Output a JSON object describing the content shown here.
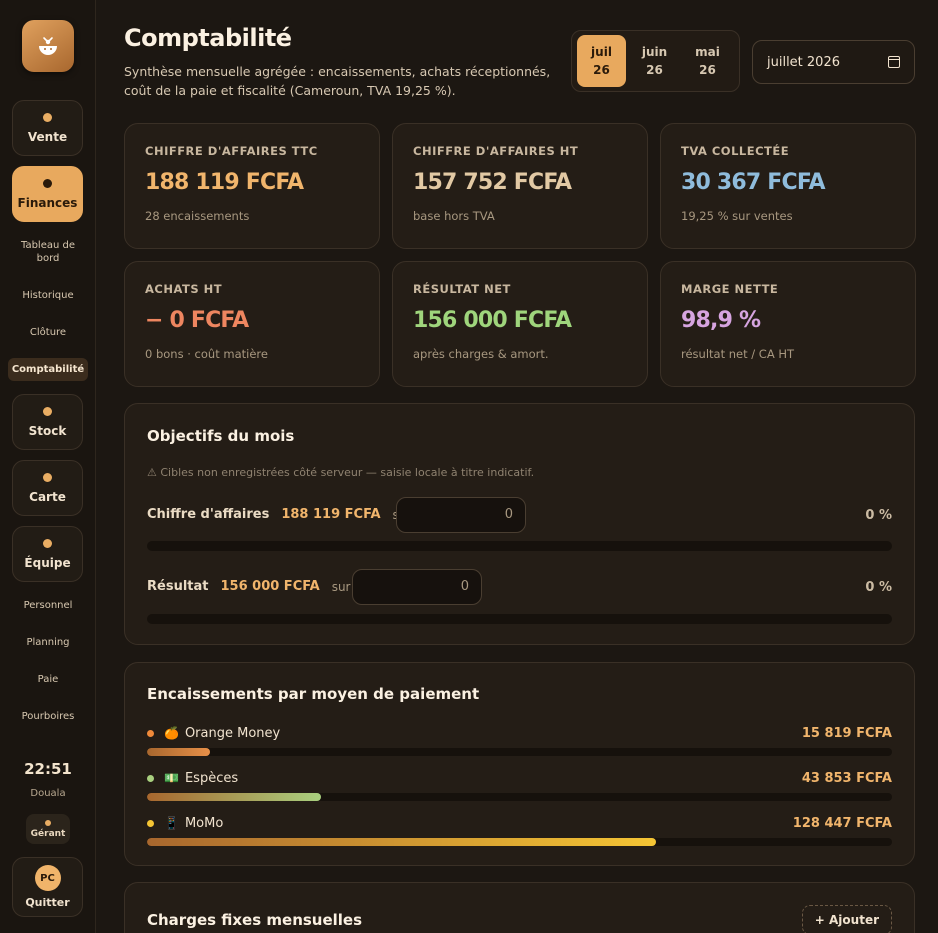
{
  "sidebar": {
    "nav": {
      "vente": "Vente",
      "finances": "Finances",
      "stock": "Stock",
      "carte": "Carte",
      "equipe": "Équipe"
    },
    "finances_sub": [
      "Tableau de bord",
      "Historique",
      "Clôture",
      "Comptabilité"
    ],
    "equipe_sub": [
      "Personnel",
      "Planning",
      "Paie",
      "Pourboires"
    ],
    "clock": "22:51",
    "city": "Douala",
    "role": "Gérant",
    "user_initials": "PC",
    "quit": "Quitter"
  },
  "header": {
    "title": "Comptabilité",
    "subtitle": "Synthèse mensuelle agrégée : encaissements, achats réceptionnés, coût de la paie et fiscalité (Cameroun, TVA 19,25 %).",
    "months": [
      {
        "m": "juil",
        "y": "26"
      },
      {
        "m": "juin",
        "y": "26"
      },
      {
        "m": "mai",
        "y": "26"
      }
    ],
    "date_value": "juillet 2026"
  },
  "kpis": [
    {
      "label": "CHIFFRE D'AFFAIRES TTC",
      "value": "188 119 FCFA",
      "note": "28 encaissements",
      "color": "#f1b56c"
    },
    {
      "label": "CHIFFRE D'AFFAIRES HT",
      "value": "157 752 FCFA",
      "note": "base hors TVA",
      "color": "#e2c9a4"
    },
    {
      "label": "TVA COLLECTÉE",
      "value": "30 367 FCFA",
      "note": "19,25 % sur ventes",
      "color": "#8fbcdc"
    },
    {
      "label": "ACHATS HT",
      "value": "− 0 FCFA",
      "note": "0 bons · coût matière",
      "color": "#ee8660"
    },
    {
      "label": "RÉSULTAT NET",
      "value": "156 000 FCFA",
      "note": "après charges & amort.",
      "color": "#9fd57c"
    },
    {
      "label": "MARGE NETTE",
      "value": "98,9 %",
      "note": "résultat net / CA HT",
      "color": "#d6a4e0"
    }
  ],
  "objectives": {
    "title": "Objectifs du mois",
    "warning": "⚠ Cibles non enregistrées côté serveur — saisie locale à titre indicatif.",
    "rows": [
      {
        "label": "Chiffre d'affaires",
        "value": "188 119 FCFA",
        "sur": "sur",
        "input": "0",
        "pct": "0 %",
        "progress": 0
      },
      {
        "label": "Résultat",
        "value": "156 000 FCFA",
        "sur": "sur",
        "input": "0",
        "pct": "0 %",
        "progress": 0
      }
    ]
  },
  "payments": {
    "title": "Encaissements par moyen de paiement",
    "rows": [
      {
        "icon": "🍊",
        "name": "Orange Money",
        "amount": "15 819 FCFA",
        "value": 15819,
        "dot": "#f08a3a",
        "from": "#a8672e",
        "to": "#e89048"
      },
      {
        "icon": "💵",
        "name": "Espèces",
        "amount": "43 853 FCFA",
        "value": 43853,
        "dot": "#a9d07f",
        "from": "#a8672e",
        "to": "#a9d07f"
      },
      {
        "icon": "📱",
        "name": "MoMo",
        "amount": "128 447 FCFA",
        "value": 128447,
        "dot": "#f5c534",
        "from": "#a8672e",
        "to": "#f5c534"
      }
    ],
    "max_value": 188119
  },
  "charges": {
    "title": "Charges fixes mensuelles",
    "add": "+ Ajouter"
  }
}
